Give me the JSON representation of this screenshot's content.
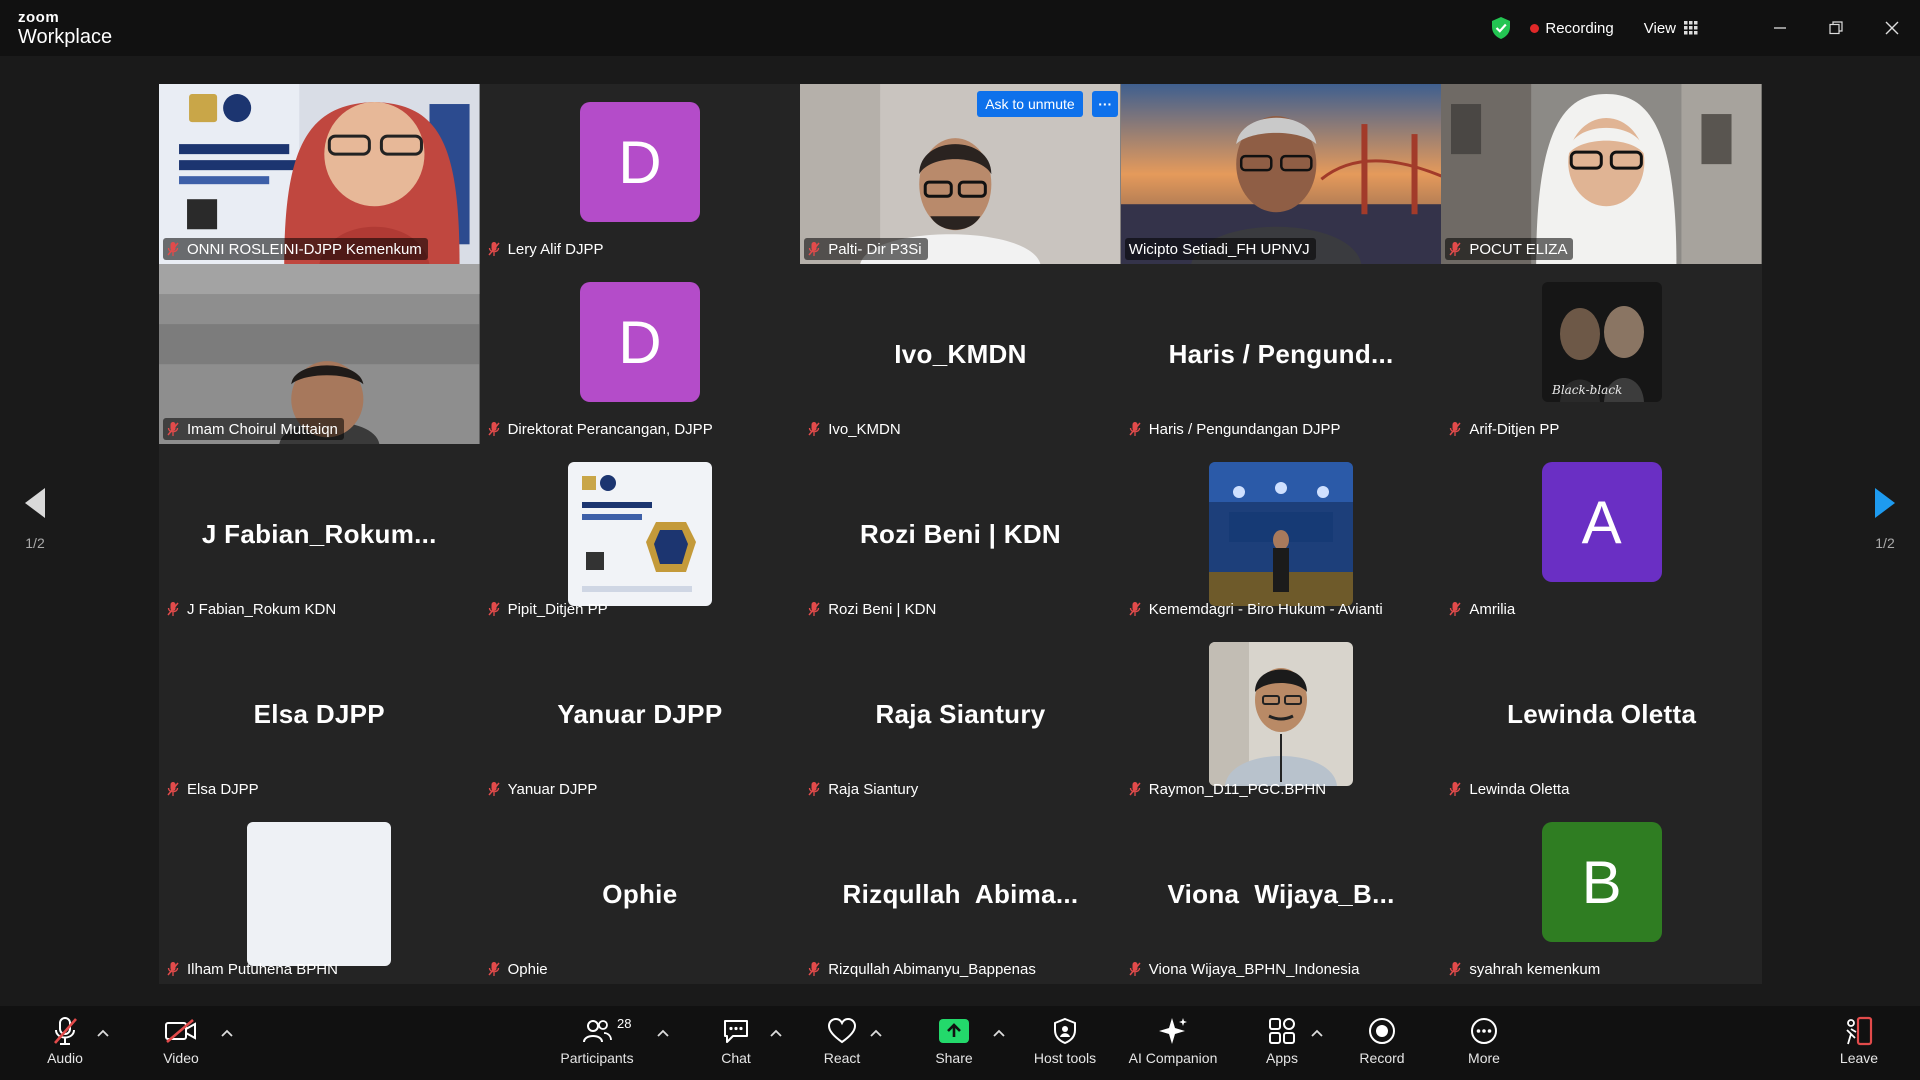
{
  "app": {
    "brand_small": "zoom",
    "brand_large": "Workplace"
  },
  "titlebar": {
    "recording_label": "Recording",
    "view_label": "View"
  },
  "ask_unmute": {
    "label": "Ask to unmute",
    "more": "···"
  },
  "pager": {
    "left_page": "1/2",
    "right_page": "1/2"
  },
  "tiles": [
    {
      "name": "ONNI ROSLEINI-DJPP Kemenkum"
    },
    {
      "name": "Lery Alif DJPP",
      "initial": "D"
    },
    {
      "name": "Palti- Dir P3Si"
    },
    {
      "name": "Wicipto Setiadi_FH UPNVJ"
    },
    {
      "name": "POCUT ELIZA"
    },
    {
      "name": "Imam Choirul Muttaiqn"
    },
    {
      "name": "Direktorat Perancangan, DJPP",
      "initial": "D"
    },
    {
      "name": "Ivo_KMDN",
      "display": "Ivo_KMDN"
    },
    {
      "name": "Haris / Pengundangan DJPP",
      "display": "Haris / Pengund..."
    },
    {
      "name": "Arif-Ditjen PP",
      "thumb_text": "Black-black"
    },
    {
      "name": "J Fabian_Rokum KDN",
      "display": "J Fabian_Rokum..."
    },
    {
      "name": "Pipit_Ditjen PP"
    },
    {
      "name": "Rozi Beni | KDN",
      "display": "Rozi Beni | KDN"
    },
    {
      "name": "Kememdagri - Biro Hukum - Avianti"
    },
    {
      "name": "Amrilia",
      "initial": "A"
    },
    {
      "name": "Elsa DJPP",
      "display": "Elsa DJPP"
    },
    {
      "name": "Yanuar DJPP",
      "display": "Yanuar DJPP"
    },
    {
      "name": "Raja Siantury",
      "display": "Raja Siantury"
    },
    {
      "name": "Raymon_D11_PGC.BPHN"
    },
    {
      "name": "Lewinda Oletta",
      "display": "Lewinda Oletta"
    },
    {
      "name": "Ilham Putuhena BPHN"
    },
    {
      "name": "Ophie",
      "display": "Ophie"
    },
    {
      "name": "Rizqullah Abimanyu_Bappenas",
      "display": "Rizqullah  Abima..."
    },
    {
      "name": "Viona Wijaya_BPHN_Indonesia",
      "display": "Viona  Wijaya_B..."
    },
    {
      "name": "syahrah kemenkum",
      "initial": "B"
    }
  ],
  "toolbar": {
    "audio": "Audio",
    "video": "Video",
    "participants": "Participants",
    "participants_count": "28",
    "chat": "Chat",
    "react": "React",
    "share": "Share",
    "host_tools": "Host tools",
    "ai_companion": "AI Companion",
    "apps": "Apps",
    "record": "Record",
    "more": "More",
    "leave": "Leave"
  },
  "colors": {
    "accent": "#0e71eb",
    "active_speaker": "#23d96b",
    "recording": "#e02828",
    "avatar_purple": "#b44cc9",
    "avatar_violet": "#6a2fc4",
    "avatar_green": "#2f7d22",
    "share_green": "#23d96b"
  }
}
